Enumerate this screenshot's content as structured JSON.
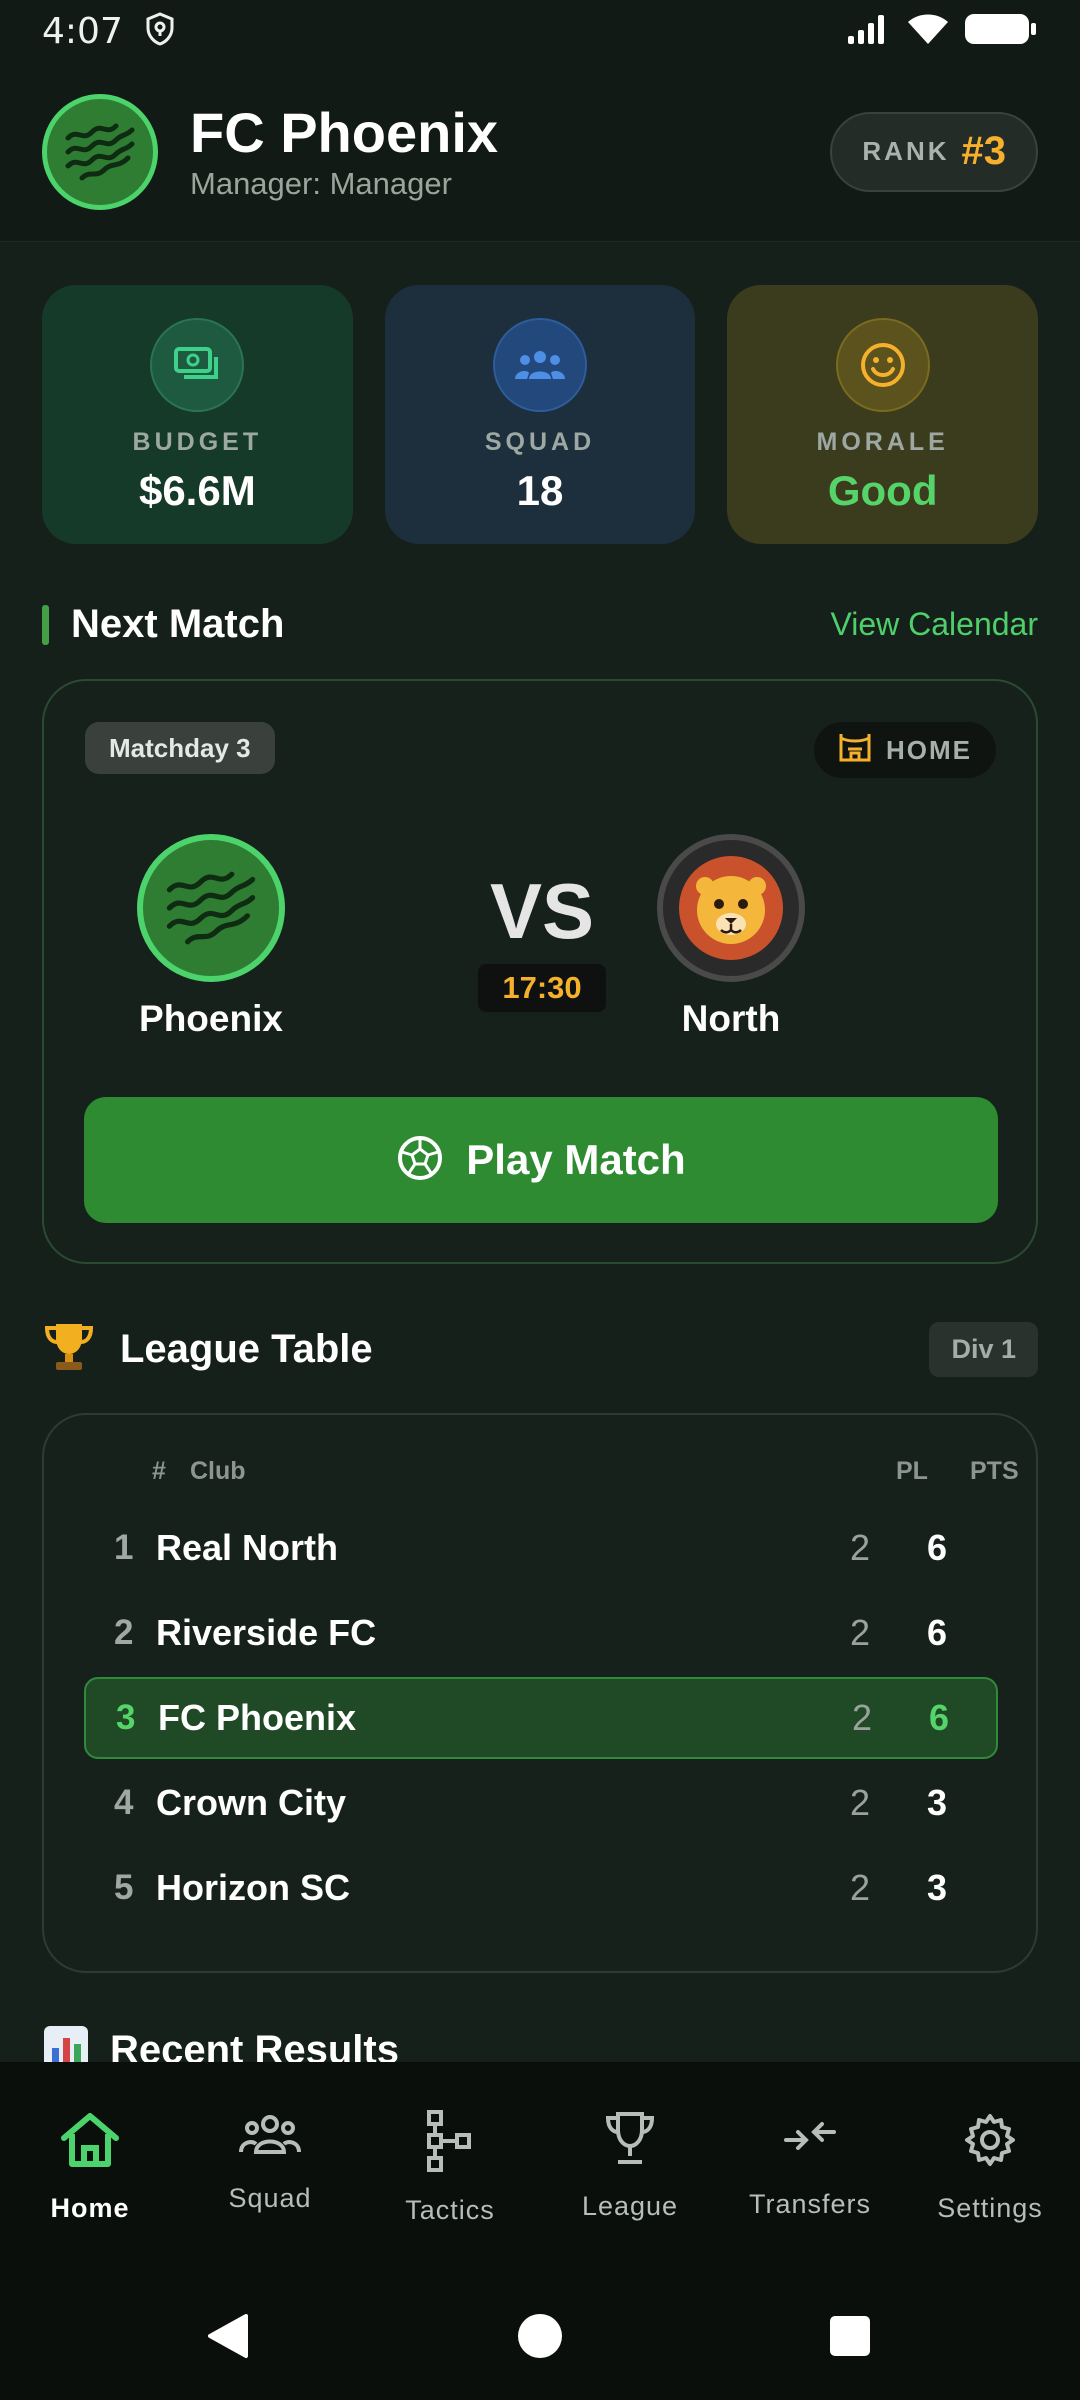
{
  "status_bar": {
    "time": "4:07"
  },
  "header": {
    "club_name": "FC Phoenix",
    "manager": "Manager: Manager",
    "rank_label": "RANK",
    "rank_value": "#3"
  },
  "stats": [
    {
      "label": "BUDGET",
      "value": "$6.6M",
      "icon": "cash-icon"
    },
    {
      "label": "SQUAD",
      "value": "18",
      "icon": "group-icon"
    },
    {
      "label": "MORALE",
      "value": "Good",
      "icon": "smiley-icon"
    }
  ],
  "next_match": {
    "section_title": "Next Match",
    "view_calendar": "View Calendar",
    "matchday": "Matchday 3",
    "venue": "HOME",
    "home_team": "Phoenix",
    "away_team": "North",
    "vs": "VS",
    "kickoff": "17:30",
    "play_button": "Play Match"
  },
  "league_table": {
    "section_title": "League Table",
    "division": "Div 1",
    "headers": {
      "pos": "#",
      "club": "Club",
      "pl": "PL",
      "pts": "PTS"
    },
    "rows": [
      {
        "pos": "1",
        "club": "Real North",
        "pl": "2",
        "pts": "6"
      },
      {
        "pos": "2",
        "club": "Riverside FC",
        "pl": "2",
        "pts": "6"
      },
      {
        "pos": "3",
        "club": "FC Phoenix",
        "pl": "2",
        "pts": "6",
        "highlight": true
      },
      {
        "pos": "4",
        "club": "Crown City",
        "pl": "2",
        "pts": "3"
      },
      {
        "pos": "5",
        "club": "Horizon SC",
        "pl": "2",
        "pts": "3"
      }
    ]
  },
  "recent_results": {
    "section_title": "Recent Results"
  },
  "bottom_nav": [
    {
      "label": "Home",
      "icon": "home-icon",
      "active": true
    },
    {
      "label": "Squad",
      "icon": "squad-icon"
    },
    {
      "label": "Tactics",
      "icon": "tactics-icon"
    },
    {
      "label": "League",
      "icon": "trophy-icon"
    },
    {
      "label": "Transfers",
      "icon": "transfers-icon"
    },
    {
      "label": "Settings",
      "icon": "gear-icon"
    }
  ],
  "colors": {
    "accent_green": "#2e8b31",
    "highlight_green": "#55d46a",
    "gold": "#f6b12c",
    "background": "#15201a"
  }
}
